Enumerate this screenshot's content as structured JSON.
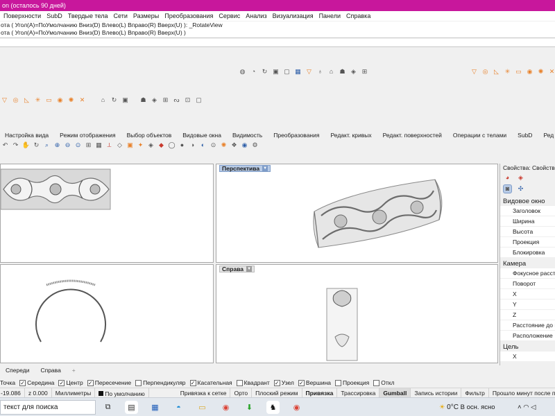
{
  "window": {
    "title": "on (осталось 90 дней)"
  },
  "menu": [
    "Поверхности",
    "SubD",
    "Твердые тела",
    "Сети",
    "Размеры",
    "Преобразования",
    "Сервис",
    "Анализ",
    "Визуализация",
    "Панели",
    "Справка"
  ],
  "command_history": {
    "line1": "ота ( Угол(A)=ПоУмолчанию  Вниз(D)  Влево(L)  Вправо(R)  Вверх(U) ): _RotateView",
    "line2": "ота ( Угол(A)=ПоУмолчанию  Вниз(D)  Влево(L)  Вправо(R)  Вверх(U) )"
  },
  "toolbar_tabs": [
    "Настройка вида",
    "Режим отображения",
    "Выбор объектов",
    "Видовые окна",
    "Видимость",
    "Преобразования",
    "Редакт. кривых",
    "Редакт. поверхностей",
    "Операции с телами",
    "SubD",
    "Ред"
  ],
  "viewports": {
    "perspective": {
      "label": "Перспектива"
    },
    "right": {
      "label": "Справа"
    }
  },
  "properties": {
    "title": "Свойства: Свойства",
    "section_viewport": "Видовое окно",
    "viewport_rows": [
      "Заголовок",
      "Ширина",
      "Высота",
      "Проекция",
      "Блокировка"
    ],
    "section_camera": "Камера",
    "camera_rows": [
      "Фокусное рассто",
      "Поворот",
      "X",
      "Y",
      "Z",
      "Расстояние до ц",
      "Расположение"
    ],
    "section_target": "Цель",
    "target_rows": [
      "X"
    ]
  },
  "bottom_tabs": [
    "Спереди",
    "Справа"
  ],
  "bottom_tabs_add": "+",
  "osnaps": [
    {
      "label": "Точка",
      "checked": true
    },
    {
      "label": "Середина",
      "checked": true
    },
    {
      "label": "Центр",
      "checked": true
    },
    {
      "label": "Пересечение",
      "checked": true
    },
    {
      "label": "Перпендикуляр",
      "checked": false
    },
    {
      "label": "Касательная",
      "checked": true
    },
    {
      "label": "Квадрант",
      "checked": false
    },
    {
      "label": "Узел",
      "checked": true
    },
    {
      "label": "Вершина",
      "checked": true
    },
    {
      "label": "Проекция",
      "checked": false
    },
    {
      "label": "Откл",
      "checked": false
    }
  ],
  "status": {
    "coord_y": "-19.086",
    "coord_z": "z 0.000",
    "units": "Миллиметры",
    "layer": "По умолчанию",
    "grid_snap": "Привязка к сетке",
    "ortho": "Орто",
    "planar": "Плоский режим",
    "osnap": "Привязка",
    "smarttrack": "Трассировка",
    "gumball": "Gumball",
    "history": "Запись истории",
    "filter": "Фильтр",
    "message": "Прошло минут после по"
  },
  "taskbar": {
    "search_placeholder": "текст для поиска",
    "weather_temp": "0°C",
    "weather_desc": "В осн. ясно"
  }
}
